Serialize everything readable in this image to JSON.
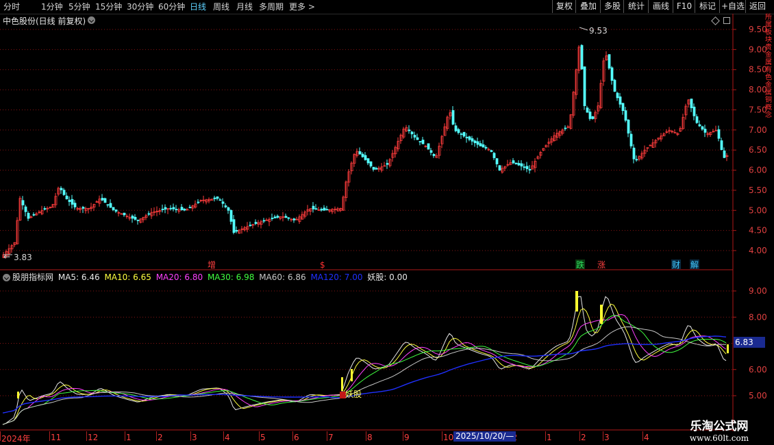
{
  "toolbar": {
    "periods": [
      "分时",
      "1分钟",
      "5分钟",
      "15分钟",
      "30分钟",
      "60分钟",
      "日线",
      "周线",
      "月线",
      "多周期",
      "更多"
    ],
    "active_period": "日线",
    "buttons": [
      "复权",
      "叠加",
      "多股",
      "统计",
      "画线",
      "F10",
      "标记",
      "+自选",
      "返回"
    ]
  },
  "main_chart": {
    "title": "中色股份(日线 前复权)",
    "high_label": "9.53",
    "low_label": "3.83",
    "price_ticks": [
      "9.50",
      "9.00",
      "8.50",
      "8.00",
      "7.50",
      "7.00",
      "6.50",
      "6.00",
      "5.50",
      "5.00",
      "4.50",
      "4.00"
    ],
    "markers": [
      {
        "text": "增",
        "color": "#ff4040"
      },
      {
        "text": "$",
        "color": "#ff3030"
      },
      {
        "text": "跌",
        "color": "#30e060"
      },
      {
        "text": "涨",
        "color": "#ff4040"
      },
      {
        "text": "财",
        "color": "#40c8ff"
      },
      {
        "text": "解",
        "color": "#40c8ff"
      }
    ],
    "colors": {
      "up": "#ff3c3c",
      "down": "#54ffff",
      "grid": "#8a1414"
    }
  },
  "indicator": {
    "name": "股朋指标网",
    "legend": [
      {
        "label": "MA5: 6.46",
        "color": "#e8e8e8"
      },
      {
        "label": "MA10: 6.65",
        "color": "#ffff40"
      },
      {
        "label": "MA20: 6.80",
        "color": "#ff40ff"
      },
      {
        "label": "MA30: 6.98",
        "color": "#40ff40"
      },
      {
        "label": "MA60: 6.86",
        "color": "#c8c8c8"
      },
      {
        "label": "MA120: 7.00",
        "color": "#2030ff"
      },
      {
        "label": "妖股: 0.00",
        "color": "#e8e8e8"
      }
    ],
    "ticks": [
      "9.00",
      "8.00",
      "6.00",
      "5.00"
    ],
    "current_value": "6.83",
    "signal_label": "妖股"
  },
  "date_axis": {
    "labels": [
      "2024年",
      "11",
      "12",
      "1",
      "2",
      "3",
      "4",
      "5",
      "6",
      "7",
      "8",
      "9",
      "10",
      "12",
      "1",
      "2",
      "3",
      "4"
    ],
    "crosshair_date": "2025/10/20/—"
  },
  "watermark": {
    "title": "乐淘公式网",
    "url": "www.60lt.com"
  },
  "right_edge_text": "所属板块贵金属有色金属铜概念"
}
